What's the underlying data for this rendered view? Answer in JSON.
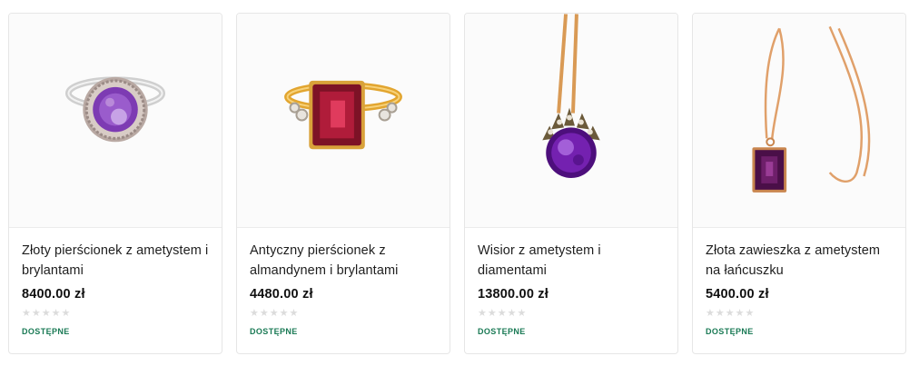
{
  "products": [
    {
      "title": "Złoty pierścionek z ametystem i brylantami",
      "price": "8400.00 zł",
      "rating": "0",
      "availability": "DOSTĘPNE",
      "image_icon": "amethyst-diamond-ring-icon"
    },
    {
      "title": "Antyczny pierścionek z almandynem i brylantami",
      "price": "4480.00 zł",
      "rating": "0",
      "availability": "DOSTĘPNE",
      "image_icon": "almandine-ring-icon"
    },
    {
      "title": "Wisior z ametystem i diamentami",
      "price": "13800.00 zł",
      "rating": "0",
      "availability": "DOSTĘPNE",
      "image_icon": "amethyst-pendant-icon"
    },
    {
      "title": "Złota zawieszka z ametystem na łańcuszku",
      "price": "5400.00 zł",
      "rating": "0",
      "availability": "DOSTĘPNE",
      "image_icon": "amethyst-chain-pendant-icon"
    }
  ],
  "colors": {
    "availability": "#1a7a55",
    "star_empty": "#dcdcdc",
    "amethyst": "#6a1f9a",
    "almandine": "#b01c3a",
    "gold": "#d9a23a"
  }
}
